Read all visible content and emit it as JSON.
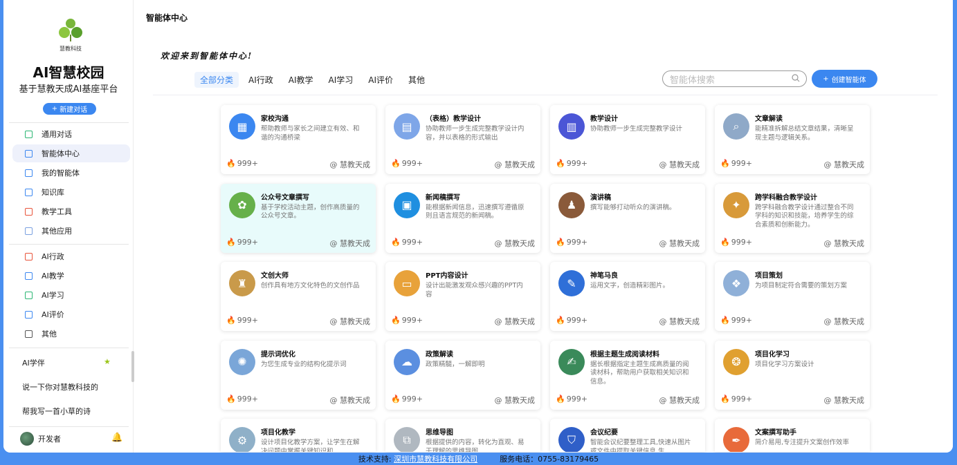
{
  "sidebar": {
    "logo_text": "慧教科技",
    "title": "AI智慧校园",
    "subtitle": "基于慧教天成AI基座平台",
    "new_chat": "新建对话",
    "nav_top": [
      {
        "label": "通用对话",
        "icon": "chat-icon",
        "color": "#2bb673"
      },
      {
        "label": "智能体中心",
        "icon": "agent-center-icon",
        "color": "#3b87f0"
      },
      {
        "label": "我的智能体",
        "icon": "user-icon",
        "color": "#3b87f0"
      },
      {
        "label": "知识库",
        "icon": "database-icon",
        "color": "#3b87f0"
      },
      {
        "label": "教学工具",
        "icon": "ppt-icon",
        "color": "#e8533a"
      },
      {
        "label": "其他应用",
        "icon": "apps-icon",
        "color": "#7aa0e0"
      }
    ],
    "nav_cats": [
      {
        "label": "AI行政",
        "icon": "admin-icon",
        "color": "#e8533a"
      },
      {
        "label": "AI教学",
        "icon": "teach-icon",
        "color": "#3b87f0"
      },
      {
        "label": "AI学习",
        "icon": "study-icon",
        "color": "#2bb673"
      },
      {
        "label": "AI评价",
        "icon": "star-icon",
        "color": "#3b87f0"
      },
      {
        "label": "其他",
        "icon": "grid-icon",
        "color": "#555555"
      }
    ],
    "history": [
      "AI学伴",
      "说一下你对慧教科技的",
      "帮我写一首小草的诗"
    ],
    "user_name": "开发者"
  },
  "main": {
    "page_title": "智能体中心",
    "welcome": "欢迎来到智能体中心!",
    "tabs": [
      "全部分类",
      "AI行政",
      "AI教学",
      "AI学习",
      "AI评价",
      "其他"
    ],
    "search_placeholder": "智能体搜索",
    "create_label": "创建智能体"
  },
  "cards": [
    {
      "title": "家校沟通",
      "desc": "帮助教师与家长之间建立有效、和谐的沟通桥梁",
      "count": "999+",
      "author": "@ 慧教天成",
      "color": "#3b87f0",
      "glyph": "▦"
    },
    {
      "title": "（表格）教学设计",
      "desc": "协助教师一步生成完整教学设计内容，并以表格的形式输出",
      "count": "999+",
      "author": "@ 慧教天成",
      "color": "#7ea6e8",
      "glyph": "▤"
    },
    {
      "title": "教学设计",
      "desc": "协助教师一步生成完整教学设计",
      "count": "999+",
      "author": "@ 慧教天成",
      "color": "#4b56d6",
      "glyph": "▥"
    },
    {
      "title": "文章解读",
      "desc": "能精准拆解总结文章结果，清晰呈现主题与逻辑关系。",
      "count": "999+",
      "author": "@ 慧教天成",
      "color": "#8fa9c8",
      "glyph": "⌕"
    },
    {
      "title": "公众号文章撰写",
      "desc": "基于学校活动主题，创作高质量的公众号文章。",
      "count": "999+",
      "author": "@ 慧教天成",
      "color": "#66b04a",
      "glyph": "✿"
    },
    {
      "title": "新闻稿撰写",
      "desc": "能根据新闻信息，迅速撰写遵循原则且语言规范的新闻稿。",
      "count": "999+",
      "author": "@ 慧教天成",
      "color": "#1f8fe0",
      "glyph": "▣"
    },
    {
      "title": "演讲稿",
      "desc": "撰写能够打动听众的演讲稿。",
      "count": "999+",
      "author": "@ 慧教天成",
      "color": "#8a5a3a",
      "glyph": "♟"
    },
    {
      "title": "跨学科融合教学设计",
      "desc": "跨学科融合教学设计通过整合不同学科的知识和技能，培养学生的综合素质和创新能力。",
      "count": "999+",
      "author": "@ 慧教天成",
      "color": "#d89a3a",
      "glyph": "✦"
    },
    {
      "title": "文创大师",
      "desc": "创作具有地方文化特色的文创作品",
      "count": "999+",
      "author": "@ 慧教天成",
      "color": "#c99a4a",
      "glyph": "♜"
    },
    {
      "title": "PPT内容设计",
      "desc": "设计出能激发观众感兴趣的PPT内容",
      "count": "999+",
      "author": "@ 慧教天成",
      "color": "#e8a23a",
      "glyph": "▭"
    },
    {
      "title": "神笔马良",
      "desc": "运用文字，创造精彩图片。",
      "count": "999+",
      "author": "@ 慧教天成",
      "color": "#2f6fd8",
      "glyph": "✎"
    },
    {
      "title": "项目策划",
      "desc": "为项目制定符合需要的策划方案",
      "count": "999+",
      "author": "@ 慧教天成",
      "color": "#8fb0d8",
      "glyph": "❖"
    },
    {
      "title": "提示词优化",
      "desc": "为您生成专业的结构化提示词",
      "count": "999+",
      "author": "@ 慧教天成",
      "color": "#7aa6d8",
      "glyph": "✺"
    },
    {
      "title": "政策解读",
      "desc": "政策精髓，一解即明",
      "count": "999+",
      "author": "@ 慧教天成",
      "color": "#5b8fe0",
      "glyph": "☁"
    },
    {
      "title": "根据主题生成阅读材料",
      "desc": "据长根据指定主题生成高质量的阅读材料，帮助用户获取相关知识和信息。",
      "count": "999+",
      "author": "@ 慧教天成",
      "color": "#3a8a5a",
      "glyph": "✍"
    },
    {
      "title": "项目化学习",
      "desc": "项目化学习方案设计",
      "count": "999+",
      "author": "@ 慧教天成",
      "color": "#e0a030",
      "glyph": "❂"
    },
    {
      "title": "项目化教学",
      "desc": "设计项目化教学方案，让学生在解决问题中掌握关键知识和",
      "count": "",
      "author": "",
      "color": "#8fb0c8",
      "glyph": "⚙"
    },
    {
      "title": "思维导图",
      "desc": "根据提供的内容，转化为直观、易于理解的思维导图",
      "count": "",
      "author": "",
      "color": "#b0b8c0",
      "glyph": "⧉"
    },
    {
      "title": "会议纪要",
      "desc": "智能会议纪要整理工具,快速从图片或文件中提取关键信息,生",
      "count": "",
      "author": "",
      "color": "#2f5fc8",
      "glyph": "⛉"
    },
    {
      "title": "文案撰写助手",
      "desc": "简介易用,专注提升文案创作效率",
      "count": "",
      "author": "",
      "color": "#e86a3a",
      "glyph": "✒"
    }
  ],
  "footer": {
    "support_label": "技术支持:",
    "company": "深圳市慧教科技有限公司",
    "phone": "服务电话：0755-83179465"
  }
}
